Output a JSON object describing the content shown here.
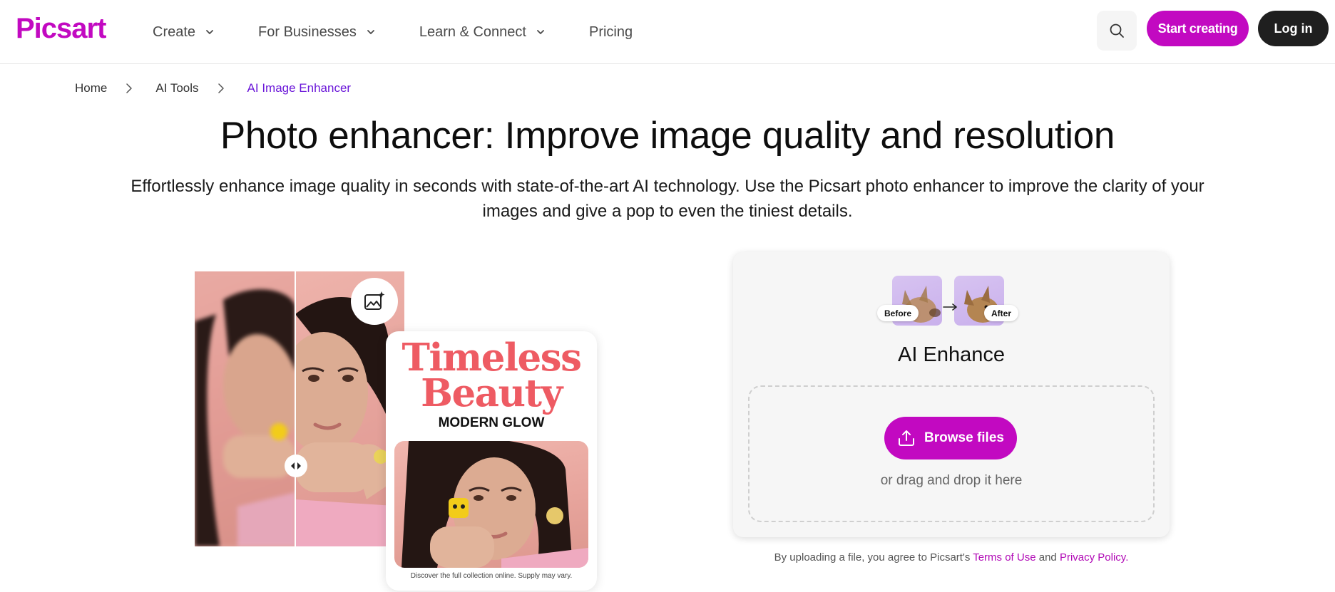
{
  "header": {
    "logo": "Picsart",
    "nav": [
      {
        "label": "Create"
      },
      {
        "label": "For Businesses"
      },
      {
        "label": "Learn & Connect"
      },
      {
        "label": "Pricing"
      }
    ],
    "start_label": "Start creating",
    "login_label": "Log in"
  },
  "breadcrumb": {
    "items": [
      "Home",
      "AI Tools",
      "AI Image Enhancer"
    ]
  },
  "hero": {
    "title": "Photo enhancer: Improve image quality and resolution",
    "subtitle": "Effortlessly enhance image quality in seconds with state-of-the-art AI technology. Use the Picsart photo enhancer to improve the clarity of your images and give a pop to even the tiniest details."
  },
  "poster": {
    "title_line1": "Timeless",
    "title_line2": "Beauty",
    "subtitle": "MODERN GLOW",
    "caption": "Discover the full collection online. Supply may vary."
  },
  "upload": {
    "before_tag": "Before",
    "after_tag": "After",
    "title": "AI Enhance",
    "browse_label": "Browse files",
    "hint": "or drag and drop it here"
  },
  "legal": {
    "prefix": "By uploading a file, you agree to Picsart's",
    "terms": "Terms of Use",
    "and": "and",
    "privacy": "Privacy Policy."
  },
  "colors": {
    "brand": "#c209c1",
    "breadcrumb_active": "#6b17d9",
    "dark_button": "#1f1f1f"
  },
  "icons": [
    "chevron-down-icon",
    "search-icon",
    "chevron-right-icon",
    "sparkle-image-icon",
    "compare-handle-icon",
    "upload-icon",
    "arrow-right-icon"
  ]
}
